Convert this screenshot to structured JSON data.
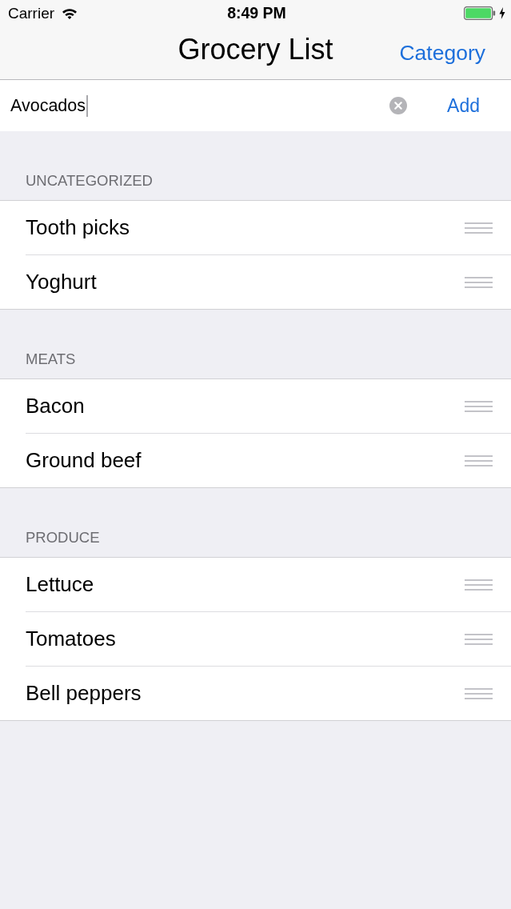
{
  "status_bar": {
    "carrier": "Carrier",
    "time": "8:49 PM",
    "battery_charging": true
  },
  "nav_bar": {
    "title": "Grocery List",
    "right_button": "Category"
  },
  "add_bar": {
    "value": "Avocados",
    "focused": true,
    "add_button": "Add"
  },
  "sections": [
    {
      "header": "UNCATEGORIZED",
      "items": [
        {
          "name": "Tooth picks"
        },
        {
          "name": "Yoghurt"
        }
      ]
    },
    {
      "header": "MEATS",
      "items": [
        {
          "name": "Bacon"
        },
        {
          "name": "Ground beef"
        }
      ]
    },
    {
      "header": "PRODUCE",
      "items": [
        {
          "name": "Lettuce"
        },
        {
          "name": "Tomatoes"
        },
        {
          "name": "Bell peppers"
        }
      ]
    }
  ]
}
